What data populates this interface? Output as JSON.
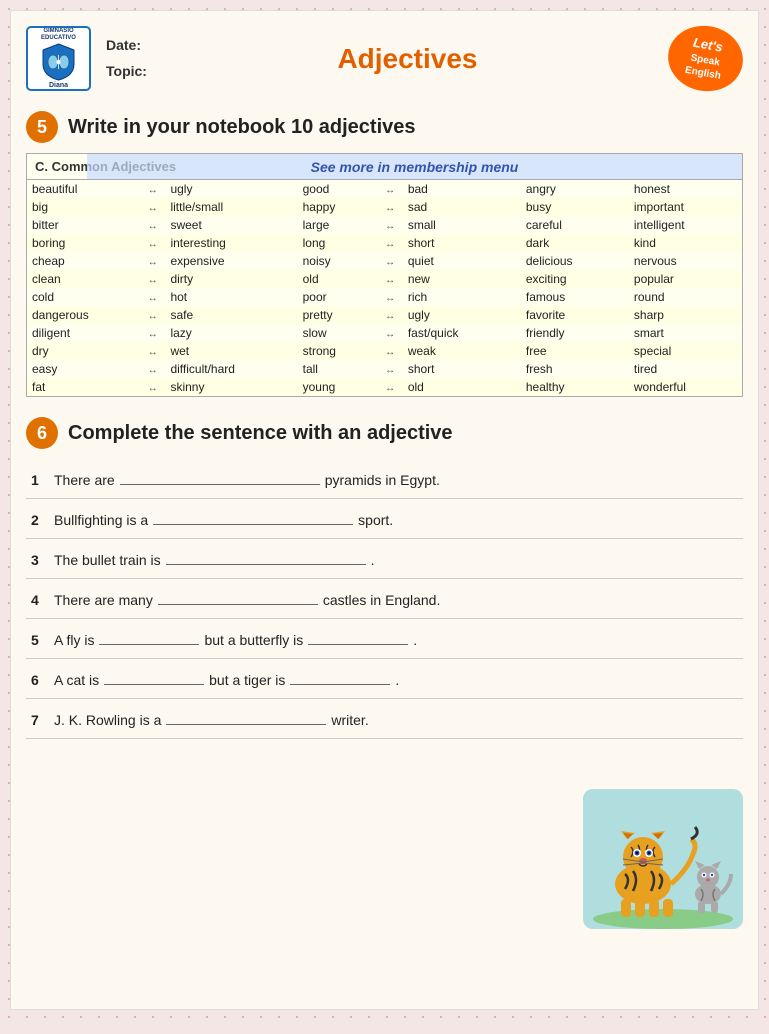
{
  "header": {
    "logo_top_text": "GIMNASIO EDUCATIVO",
    "logo_name": "Diana",
    "date_label": "Date:",
    "topic_label": "Topic:",
    "title": "Adjectives",
    "badge_line1": "Let's",
    "badge_line2": "Speak",
    "badge_line3": "English"
  },
  "section5": {
    "number": "5",
    "title": "Write in your notebook 10 adjectives"
  },
  "adjectives_table": {
    "header": "C. Common Adjectives",
    "membership_text": "See more in membership menu",
    "rows": [
      [
        "beautiful",
        "ugly",
        "good",
        "bad",
        "angry",
        "honest"
      ],
      [
        "big",
        "little/small",
        "happy",
        "sad",
        "busy",
        "important"
      ],
      [
        "bitter",
        "sweet",
        "large",
        "small",
        "careful",
        "intelligent"
      ],
      [
        "boring",
        "interesting",
        "long",
        "short",
        "dark",
        "kind"
      ],
      [
        "cheap",
        "expensive",
        "noisy",
        "quiet",
        "delicious",
        "nervous"
      ],
      [
        "clean",
        "dirty",
        "old",
        "new",
        "exciting",
        "popular"
      ],
      [
        "cold",
        "hot",
        "poor",
        "rich",
        "famous",
        "round"
      ],
      [
        "dangerous",
        "safe",
        "pretty",
        "ugly",
        "favorite",
        "sharp"
      ],
      [
        "diligent",
        "lazy",
        "slow",
        "fast/quick",
        "friendly",
        "smart"
      ],
      [
        "dry",
        "wet",
        "strong",
        "weak",
        "free",
        "special"
      ],
      [
        "easy",
        "difficult/hard",
        "tall",
        "short",
        "fresh",
        "tired"
      ],
      [
        "fat",
        "skinny",
        "young",
        "old",
        "healthy",
        "wonderful"
      ]
    ]
  },
  "section6": {
    "number": "6",
    "title": "Complete the sentence with an adjective"
  },
  "exercises": [
    {
      "num": "1",
      "before": "There are ",
      "blank_size": "long",
      "after": " pyramids in Egypt."
    },
    {
      "num": "2",
      "before": "Bullfighting is a ",
      "blank_size": "long",
      "after": " sport."
    },
    {
      "num": "3",
      "before": "The bullet train is ",
      "blank_size": "long",
      "after": "."
    },
    {
      "num": "4",
      "before": "There are many ",
      "blank_size": "medium",
      "after": " castles in England."
    },
    {
      "num": "5",
      "before": "A fly is ",
      "blank_size": "short",
      "middle": " but a butterfly is ",
      "blank2_size": "short",
      "after": "."
    },
    {
      "num": "6",
      "before": "A cat is ",
      "blank_size": "short",
      "middle": " but a tiger is ",
      "blank2_size": "short",
      "after": "."
    },
    {
      "num": "7",
      "before": "J. K. Rowling is a ",
      "blank_size": "medium",
      "after": " writer."
    }
  ]
}
